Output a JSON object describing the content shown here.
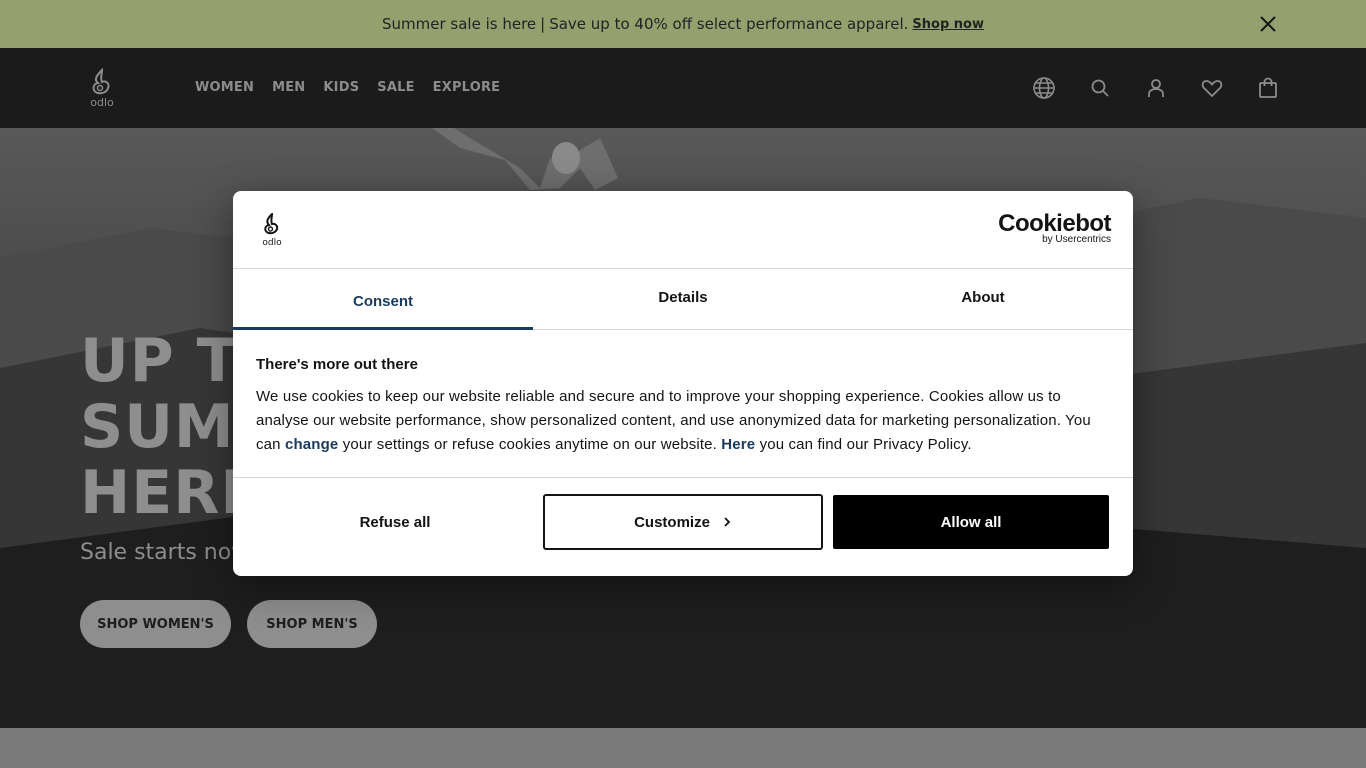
{
  "promo": {
    "text": "Summer sale is here",
    "separator": "|",
    "text2": "Save up to 40% off select performance apparel.",
    "link": "Shop now"
  },
  "header": {
    "logo_text": "odlo",
    "nav": [
      "WOMEN",
      "MEN",
      "KIDS",
      "SALE",
      "EXPLORE"
    ],
    "icons": [
      "globe-icon",
      "search-icon",
      "user-icon",
      "heart-icon",
      "bag-icon"
    ]
  },
  "hero": {
    "title_lines": [
      "UP TO",
      "SUMM",
      "HERE"
    ],
    "subtitle": "Sale starts now",
    "buttons": [
      "SHOP WOMEN'S",
      "SHOP MEN'S"
    ]
  },
  "dialog": {
    "logo_text": "odlo",
    "brand": "Cookiebot",
    "brand_sub": "by Usercentrics",
    "tabs": [
      "Consent",
      "Details",
      "About"
    ],
    "active_tab": "Consent",
    "heading": "There's more out there",
    "body_part1": "We use cookies to keep our website reliable and secure and to improve your shopping experience. Cookies allow us to analyse our website performance, show personalized content, and use anonymized data for marketing personalization. You can ",
    "body_link1": "change",
    "body_part2": " your settings or refuse cookies anytime on our website. ",
    "body_link2": "Here",
    "body_part3": " you can find our Privacy Policy.",
    "buttons": {
      "refuse": "Refuse all",
      "customize": "Customize",
      "allow": "Allow all"
    }
  },
  "colors": {
    "promo_bg": "#95a06f",
    "header_bg": "#1b1b1b",
    "accent": "#1a3b5e",
    "allow_bg": "#000000"
  }
}
